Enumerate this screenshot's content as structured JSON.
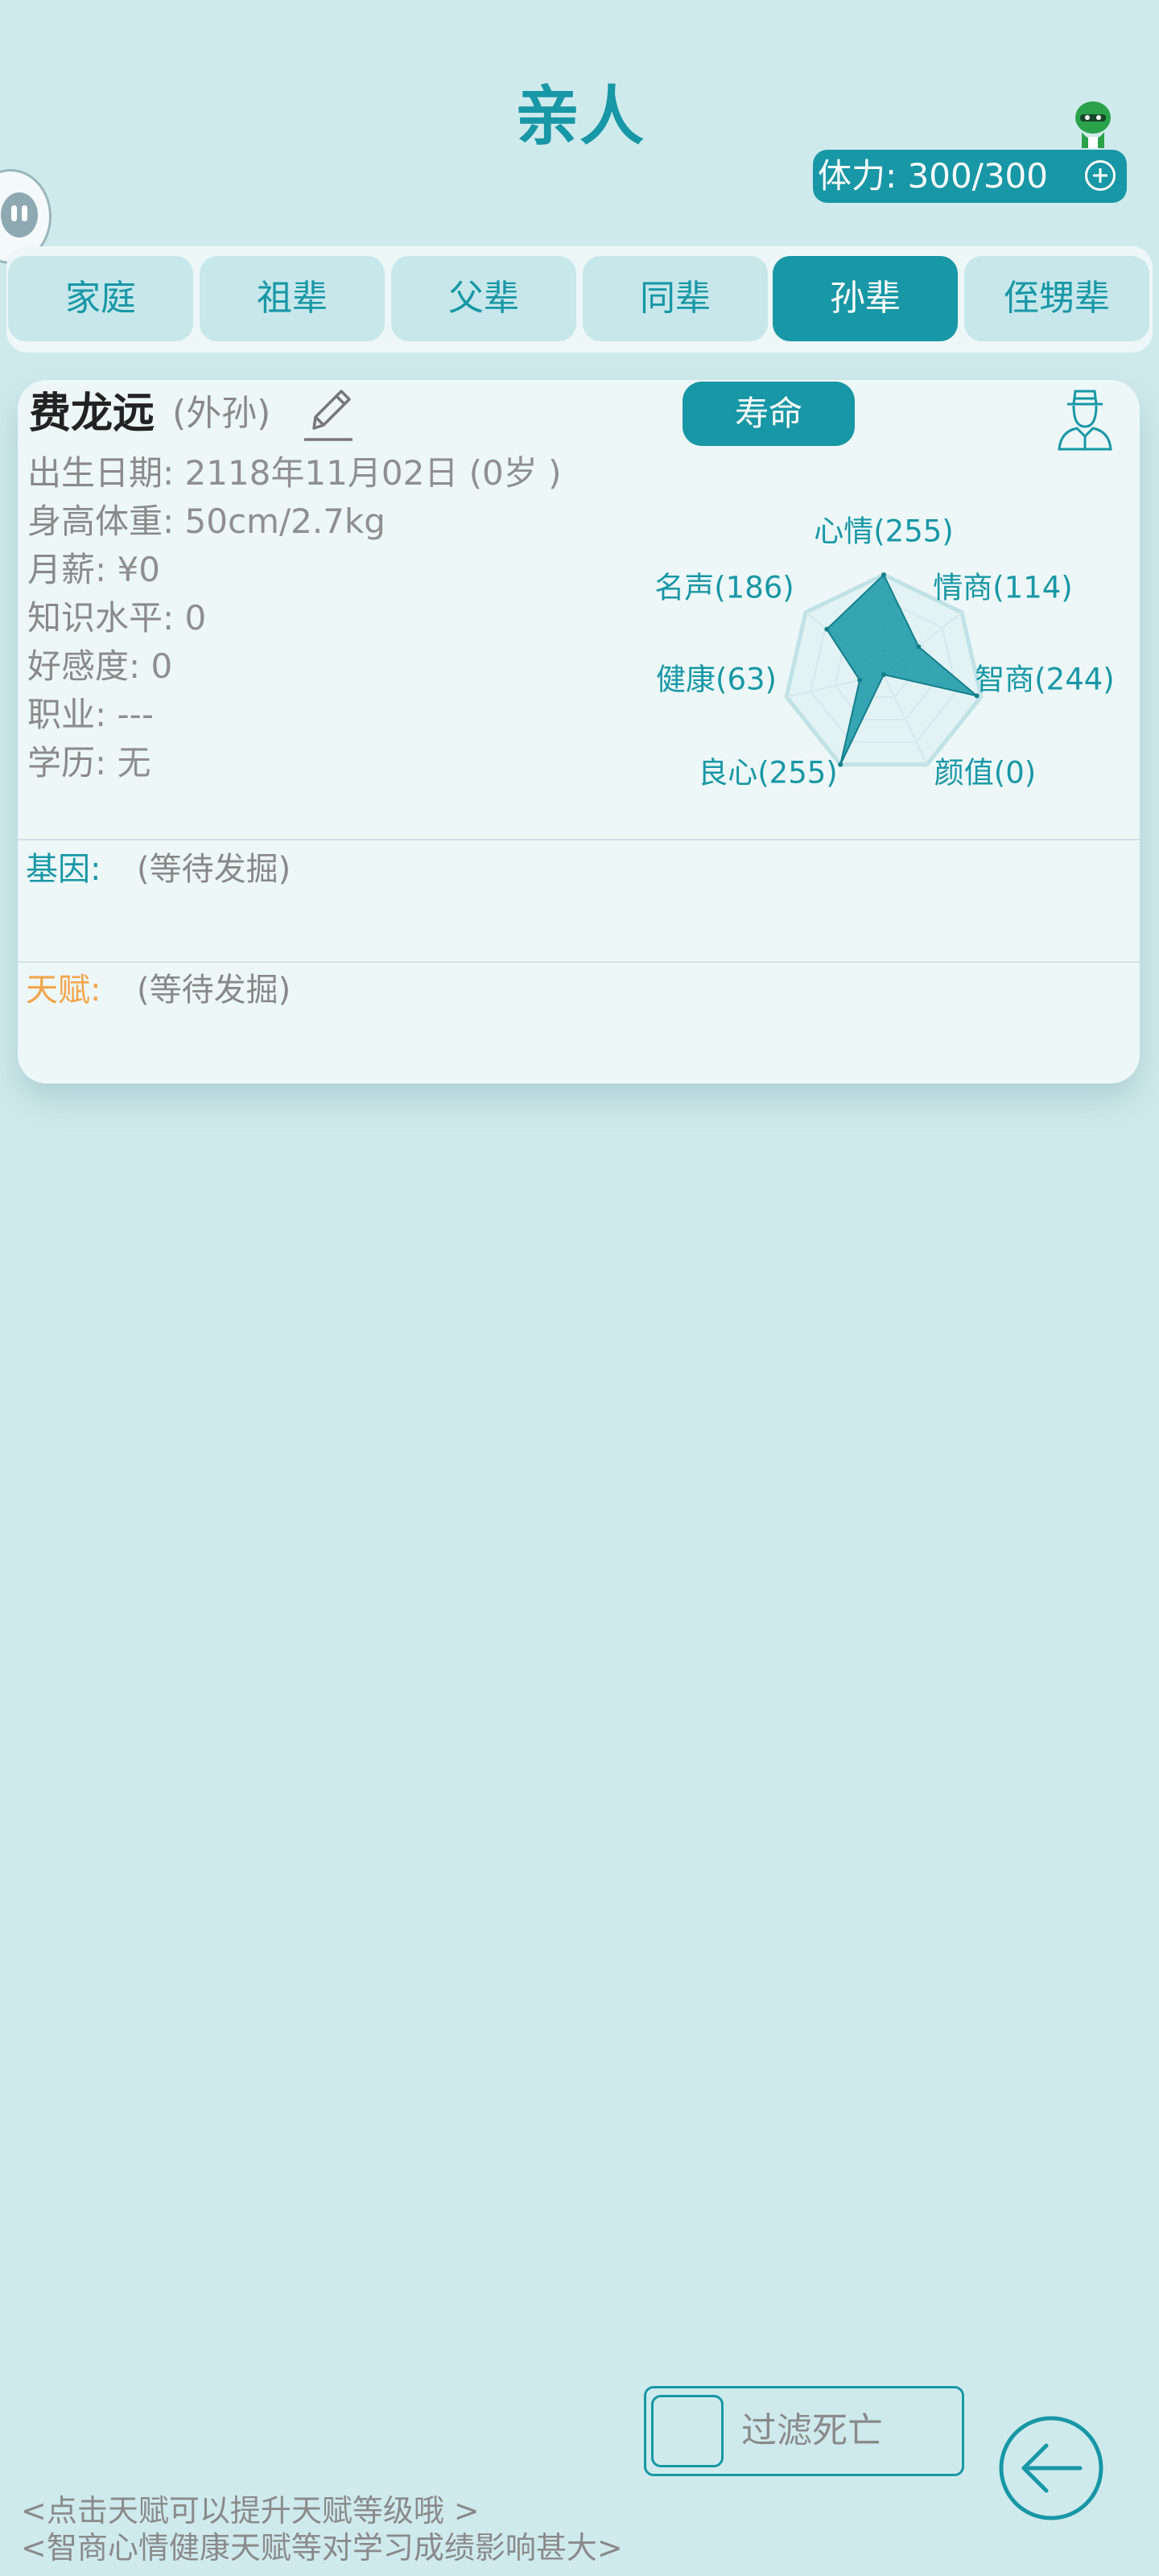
{
  "header": {
    "title": "亲人",
    "stamina": "体力: 300/300"
  },
  "tabs": [
    {
      "label": "家庭",
      "active": false
    },
    {
      "label": "祖辈",
      "active": false
    },
    {
      "label": "父辈",
      "active": false
    },
    {
      "label": "同辈",
      "active": false
    },
    {
      "label": "孙辈",
      "active": true
    },
    {
      "label": "侄甥辈",
      "active": false
    }
  ],
  "person": {
    "name": "费龙远",
    "relation": "(外孙)",
    "lifespan_button": "寿命",
    "info": [
      {
        "label": "出生日期",
        "value": ": 2118年11月02日 (0岁 )"
      },
      {
        "label": "身高体重",
        "value": ": 50cm/2.7kg"
      },
      {
        "label": "月薪",
        "value": ": ¥0"
      },
      {
        "label": "知识水平",
        "value": ": 0"
      },
      {
        "label": "好感度",
        "value": ": 0"
      },
      {
        "label": "职业",
        "value": ": ---"
      },
      {
        "label": "学历",
        "value": ": 无"
      }
    ],
    "gene_label": "基因:",
    "gene_value": "(等待发掘)",
    "talent_label": "天赋:",
    "talent_value": "(等待发掘)"
  },
  "radar": {
    "max": 255,
    "axes": [
      {
        "name": "心情",
        "value": 255,
        "label": "心情(255)"
      },
      {
        "name": "情商",
        "value": 114,
        "label": "情商(114)"
      },
      {
        "name": "智商",
        "value": 244,
        "label": "智商(244)"
      },
      {
        "name": "颜值",
        "value": 0,
        "label": "颜值(0)"
      },
      {
        "name": "良心",
        "value": 255,
        "label": "良心(255)"
      },
      {
        "name": "健康",
        "value": 63,
        "label": "健康(63)"
      },
      {
        "name": "名声",
        "value": 186,
        "label": "名声(186)"
      }
    ]
  },
  "footer": {
    "filter_label": "过滤死亡",
    "hint1": "<点击天赋可以提升天赋等级哦 >",
    "hint2": "<智商心情健康天赋等对学习成绩影响甚大>"
  },
  "colors": {
    "accent": "#1897a6",
    "background": "#cfeaec",
    "talent": "#f4a44a"
  }
}
